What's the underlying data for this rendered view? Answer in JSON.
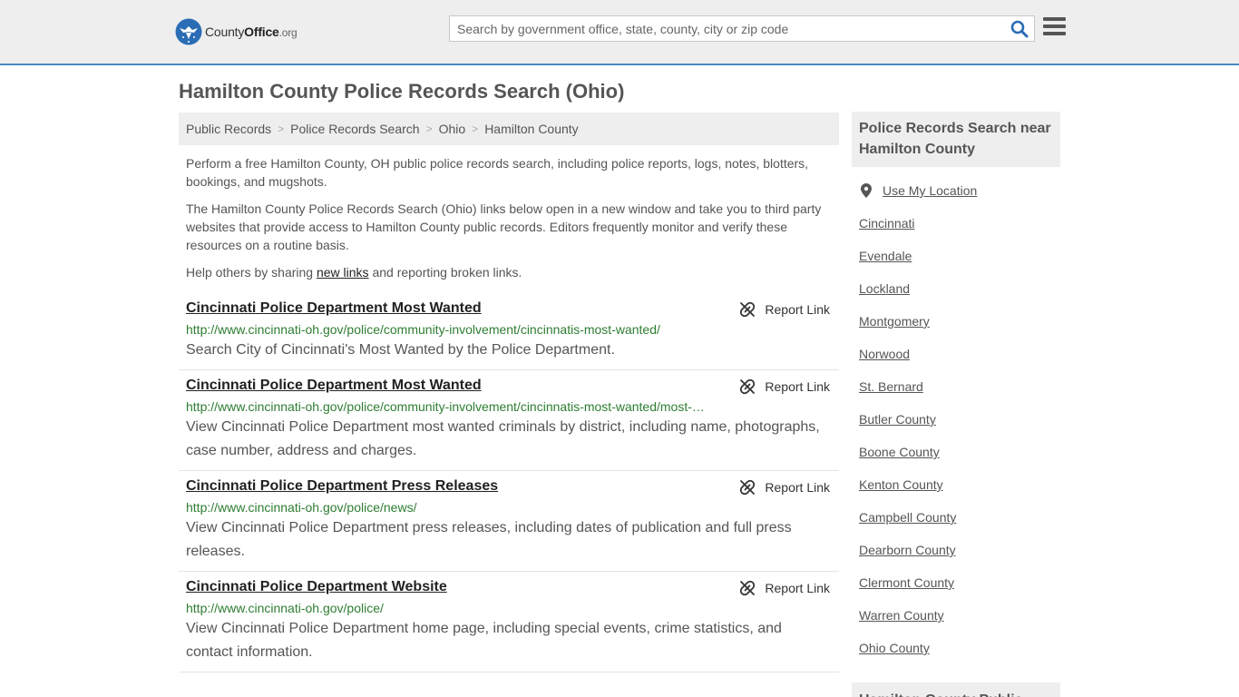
{
  "header": {
    "logo_county": "County",
    "logo_office": "Office",
    "logo_org": ".org",
    "logo_icon": "eagle-seal-icon",
    "search_placeholder": "Search by government office, state, county, city or zip code",
    "search_icon": "search-icon",
    "menu_icon": "hamburger-menu-icon"
  },
  "page": {
    "title": "Hamilton County Police Records Search (Ohio)"
  },
  "breadcrumb": [
    {
      "label": "Public Records"
    },
    {
      "label": "Police Records Search"
    },
    {
      "label": "Ohio"
    },
    {
      "label": "Hamilton County"
    }
  ],
  "intro": {
    "p1": "Perform a free Hamilton County, OH public police records search, including police reports, logs, notes, blotters, bookings, and mugshots.",
    "p2": "The Hamilton County Police Records Search (Ohio) links below open in a new window and take you to third party websites that provide access to Hamilton County public records. Editors frequently monitor and verify these resources on a routine basis.",
    "p3_before": "Help others by sharing ",
    "p3_link": "new links",
    "p3_after": " and reporting broken links."
  },
  "results": [
    {
      "title": "Cincinnati Police Department Most Wanted",
      "url": "http://www.cincinnati-oh.gov/police/community-involvement/cincinnatis-most-wanted/",
      "description": "Search City of Cincinnati's Most Wanted by the Police Department.",
      "report_label": "Report Link"
    },
    {
      "title": "Cincinnati Police Department Most Wanted",
      "url": "http://www.cincinnati-oh.gov/police/community-involvement/cincinnatis-most-wanted/most-…",
      "description": "View Cincinnati Police Department most wanted criminals by district, including name, photographs, case number, address and charges.",
      "report_label": "Report Link"
    },
    {
      "title": "Cincinnati Police Department Press Releases",
      "url": "http://www.cincinnati-oh.gov/police/news/",
      "description": "View Cincinnati Police Department press releases, including dates of publication and full press releases.",
      "report_label": "Report Link"
    },
    {
      "title": "Cincinnati Police Department Website",
      "url": "http://www.cincinnati-oh.gov/police/",
      "description": "View Cincinnati Police Department home page, including special events, crime statistics, and contact information.",
      "report_label": "Report Link"
    }
  ],
  "sidebar": {
    "heading": "Police Records Search near Hamilton County",
    "use_location": "Use My Location",
    "links": [
      "Cincinnati",
      "Evendale",
      "Lockland",
      "Montgomery",
      "Norwood",
      "St. Bernard",
      "Butler County",
      "Boone County",
      "Kenton County",
      "Campbell County",
      "Dearborn County",
      "Clermont County",
      "Warren County",
      "Ohio County"
    ],
    "heading2": "Hamilton County Public"
  },
  "colors": {
    "header_bg": "#eeeeee",
    "header_border": "#4a88c4",
    "logo_blue": "#2a6db5",
    "url_green": "#2e7d32",
    "text": "#555555",
    "search_icon": "#2a6db5"
  }
}
